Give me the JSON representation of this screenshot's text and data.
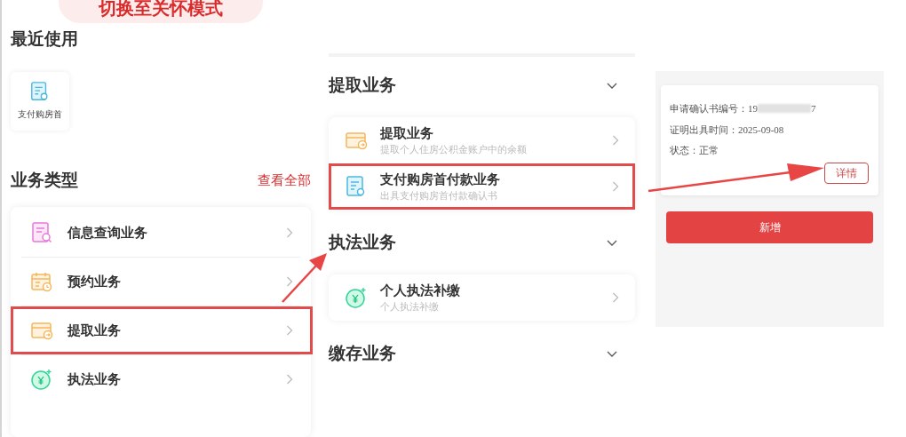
{
  "care_mode_button": "切换至关怀模式",
  "recent": {
    "title": "最近使用",
    "items": [
      {
        "label": "支付购房首"
      }
    ]
  },
  "business_types": {
    "title": "业务类型",
    "view_all": "查看全部",
    "items": [
      {
        "kind": "query",
        "label": "信息查询业务",
        "highlighted": false
      },
      {
        "kind": "booking",
        "label": "预约业务",
        "highlighted": false
      },
      {
        "kind": "withdraw",
        "label": "提取业务",
        "highlighted": true
      },
      {
        "kind": "enforcement",
        "label": "执法业务",
        "highlighted": false
      }
    ]
  },
  "sections": [
    {
      "title": "提取业务",
      "items": [
        {
          "kind": "withdraw",
          "title": "提取业务",
          "subtitle": "提取个人住房公积金账户中的余额",
          "highlighted": false
        },
        {
          "kind": "doc",
          "title": "支付购房首付款业务",
          "subtitle": "出具支付购房首付款确认书",
          "highlighted": true
        }
      ]
    },
    {
      "title": "执法业务",
      "items": [
        {
          "kind": "enforcement",
          "title": "个人执法补缴",
          "subtitle": "个人执法补缴",
          "highlighted": false
        }
      ]
    },
    {
      "title": "缴存业务"
    }
  ],
  "certificate": {
    "number_label": "申请确认书编号：",
    "number_prefix": "19",
    "number_suffix": "7",
    "date_label": "证明出具时间：",
    "date": "2025-09-08",
    "status_label": "状态：",
    "status": "正常",
    "details_button": "详情"
  },
  "add_button": "新增"
}
